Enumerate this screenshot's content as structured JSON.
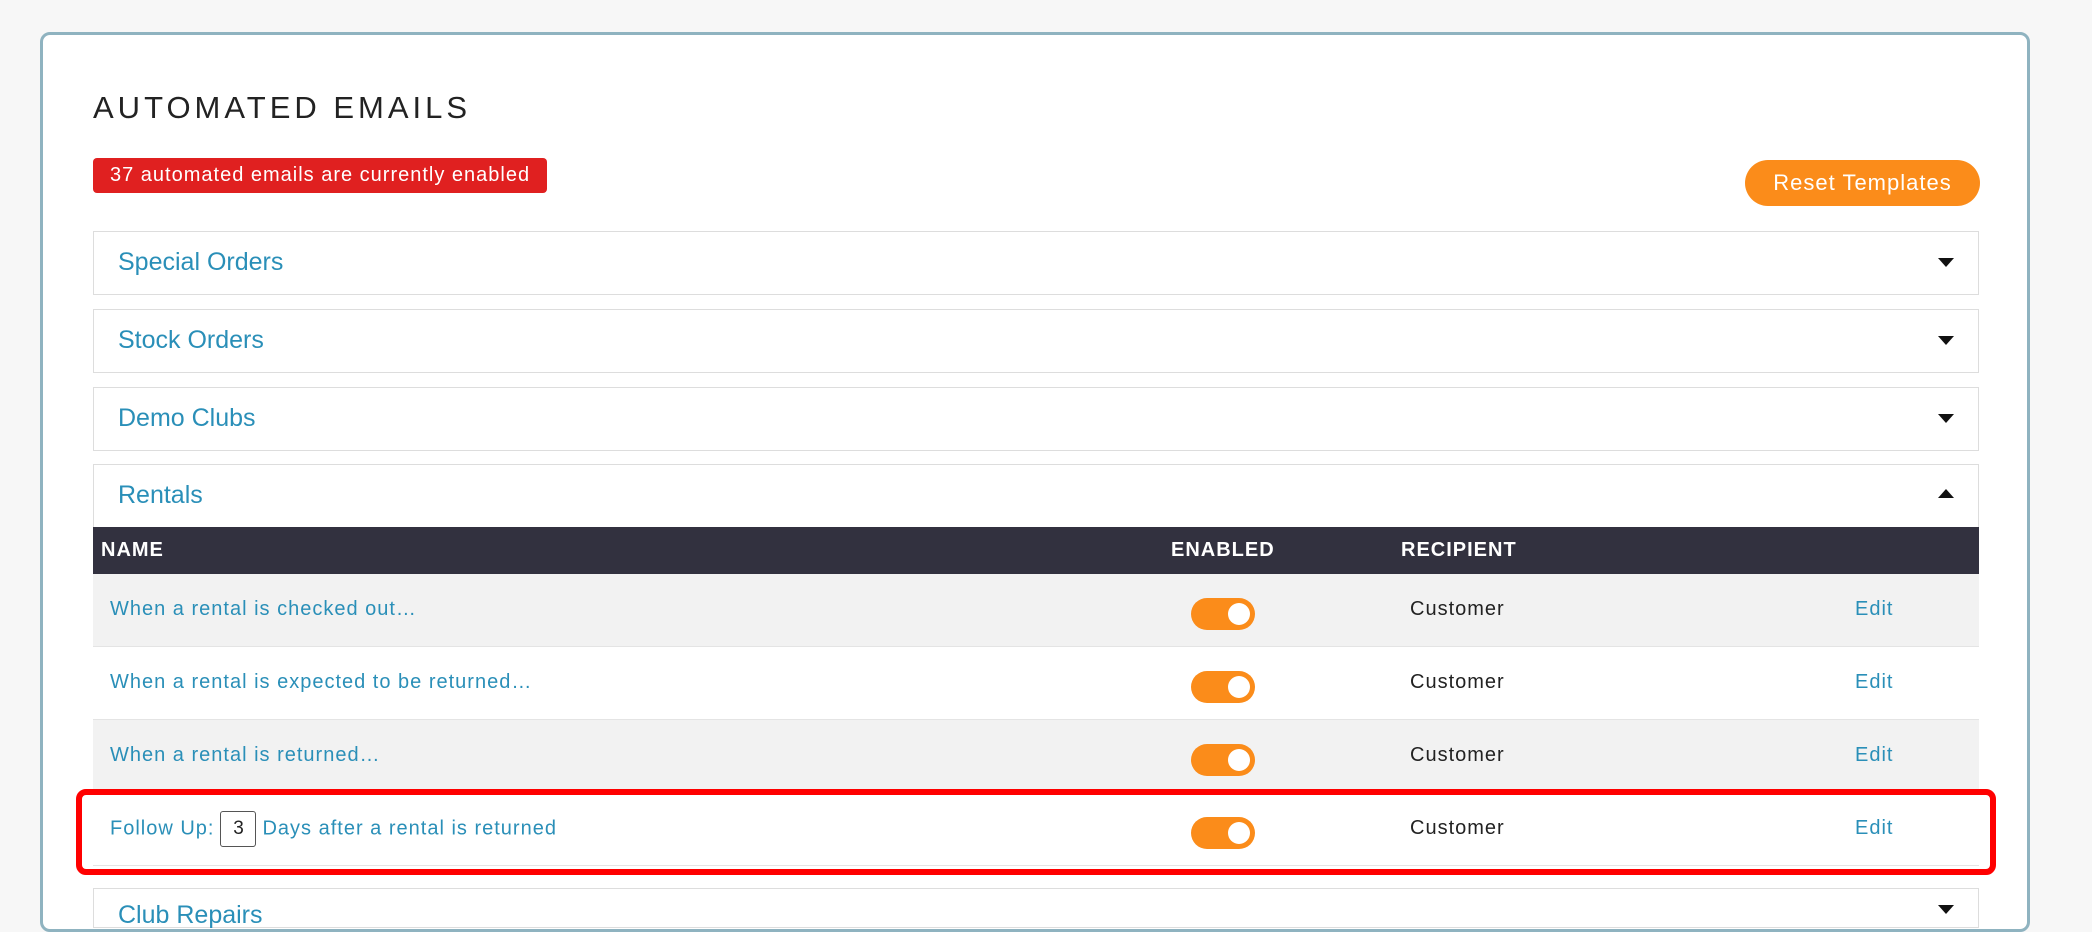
{
  "page": {
    "title": "AUTOMATED EMAILS",
    "status_badge": "37 automated emails are currently enabled",
    "reset_button": "Reset Templates"
  },
  "sections": [
    {
      "label": "Special Orders",
      "expanded": false
    },
    {
      "label": "Stock Orders",
      "expanded": false
    },
    {
      "label": "Demo Clubs",
      "expanded": false
    },
    {
      "label": "Rentals",
      "expanded": true
    },
    {
      "label": "Club Repairs",
      "expanded": false
    }
  ],
  "rentals_table": {
    "headers": {
      "name": "NAME",
      "enabled": "ENABLED",
      "recipient": "RECIPIENT"
    },
    "rows": [
      {
        "name": "When a rental is checked out…",
        "enabled": true,
        "recipient": "Customer",
        "action": "Edit"
      },
      {
        "name": "When a rental is expected to be returned…",
        "enabled": true,
        "recipient": "Customer",
        "action": "Edit"
      },
      {
        "name": "When a rental is returned…",
        "enabled": true,
        "recipient": "Customer",
        "action": "Edit"
      },
      {
        "name_prefix": "Follow Up:",
        "days_value": "3",
        "name_suffix": "Days after a rental is returned",
        "enabled": true,
        "recipient": "Customer",
        "action": "Edit"
      }
    ]
  },
  "colors": {
    "accent_orange": "#fb8c1a",
    "badge_red": "#e02020",
    "link_blue": "#2a8fb8",
    "table_header_bg": "#32313f",
    "highlight_red": "#ff0000"
  },
  "icons": {
    "collapsed": "chevron-down-icon",
    "expanded": "chevron-up-icon"
  }
}
